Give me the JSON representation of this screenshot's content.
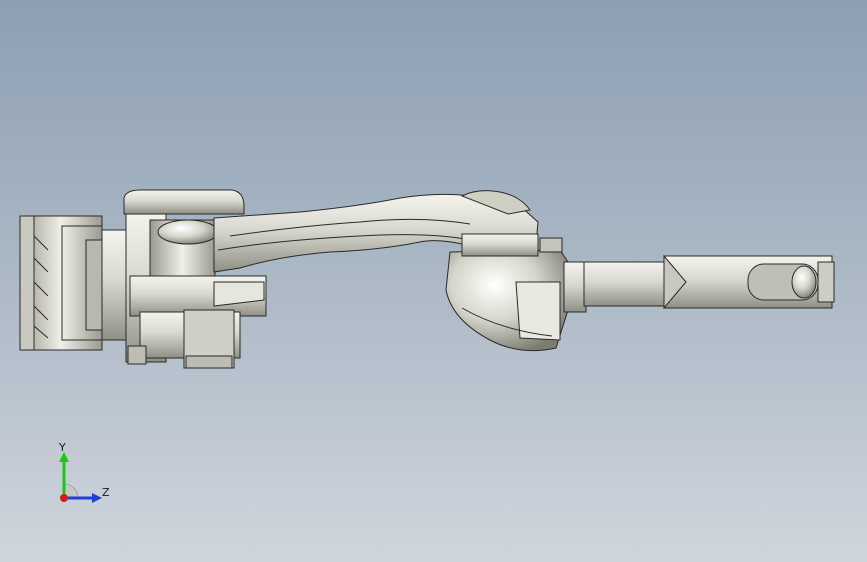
{
  "viewport": {
    "background_top": "#8c9fb3",
    "background_bottom": "#cfd5dc"
  },
  "model": {
    "icon": "robot-arm-model",
    "body_color": "#d8d8d0",
    "shadow_color": "#8f8f86",
    "outline_color": "#2a2a2a"
  },
  "triad": {
    "y_label": "Y",
    "z_label": "Z",
    "y_color": "#19c919",
    "z_color": "#1f3fd6",
    "x_color": "#d21c1c"
  }
}
